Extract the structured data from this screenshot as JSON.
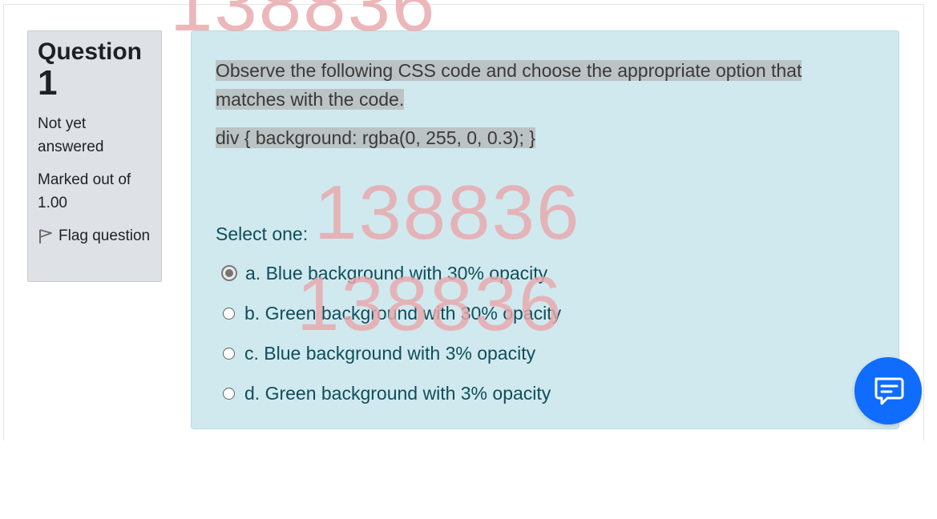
{
  "info": {
    "question_label": "Question",
    "question_number": "1",
    "state": "Not yet answered",
    "grade": "Marked out of 1.00",
    "flag_label": "Flag question"
  },
  "question": {
    "text": "Observe the following CSS code and choose the appropriate option that matches with the code.",
    "code": "div {  background: rgba(0, 255, 0, 0.3); }",
    "prompt": "Select one:",
    "options": [
      {
        "label": "a. Blue background with 30% opacity",
        "selected": true
      },
      {
        "label": "b. Green background with 30% opacity",
        "selected": false
      },
      {
        "label": "c. Blue background with 3% opacity",
        "selected": false
      },
      {
        "label": "d. Green background with 3% opacity",
        "selected": false
      }
    ]
  },
  "watermark": "138836",
  "colors": {
    "info_bg": "#dee2e6",
    "question_bg": "#d0e9ef",
    "highlight_bg": "#bcc3c4",
    "answer_text": "#0f4e5a",
    "watermark": "#e9a8ac",
    "chat_button": "#0f6cfd"
  },
  "icons": {
    "flag": "flag-icon",
    "chat": "chat-icon"
  }
}
